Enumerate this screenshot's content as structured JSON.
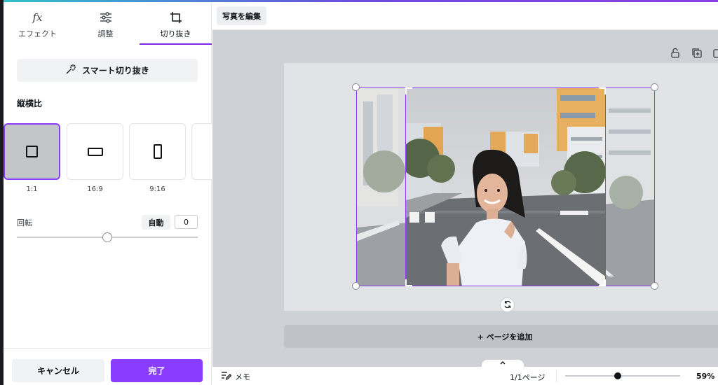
{
  "tabs": [
    {
      "label": "エフェクト",
      "icon": "fx-icon"
    },
    {
      "label": "調整",
      "icon": "sliders-icon"
    },
    {
      "label": "切り抜き",
      "icon": "crop-icon",
      "active": true
    }
  ],
  "panel": {
    "smart_crop_label": "スマート切り抜き",
    "aspect_title": "縦横比",
    "ratios": [
      {
        "label": "1:1",
        "active": true
      },
      {
        "label": "16:9"
      },
      {
        "label": "9:16"
      }
    ],
    "rotation_label": "回転",
    "auto_label": "自動",
    "rotation_value": "0",
    "rotation_fraction": 0.5,
    "cancel_label": "キャンセル",
    "done_label": "完了"
  },
  "topbar": {
    "edit_photo_label": "写真を編集"
  },
  "canvas": {
    "add_page_label": "+ ページを追加"
  },
  "bottombar": {
    "memo_label": "メモ",
    "page_count": "1/1ページ",
    "zoom_label": "59%",
    "zoom_fraction": 0.45
  },
  "colors": {
    "accent": "#8b3dff",
    "canvas_bg": "#ced1d6"
  }
}
